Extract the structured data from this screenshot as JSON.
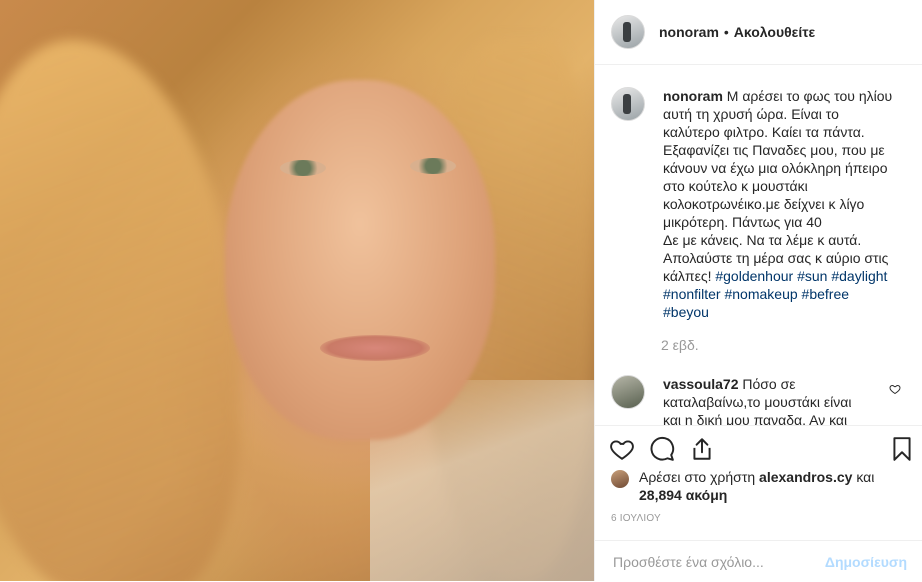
{
  "post": {
    "photo_alt": "",
    "header": {
      "username": "nonoram",
      "separator": "•",
      "follow_label": "Ακολουθείτε"
    },
    "caption": {
      "username": "nonoram",
      "text": "Μ αρέσει το φως του ηλίου αυτή τη χρυσή ώρα. Είναι το καλύτερο φιλτρο. Καίει τα πάντα. Εξαφανίζει τις Παναδες μου, που με κάνουν να έχω μια ολόκληρη ήπειρο στο κούτελο κ μουστάκι κολοκοτρωνέικο.με δείχνει κ λίγο μικρότερη. Πάντως για 40",
      "text2": "Δε με κάνεις. Να τα λέμε κ αυτά. Απολαύστε τη μέρα σας κ αύριο στις κάλπες!",
      "hashtags": [
        "#goldenhour",
        "#sun",
        "#daylight",
        "#nonfilter",
        "#nomakeup",
        "#befree",
        "#beyou"
      ],
      "time": "2 εβδ."
    },
    "comments": [
      {
        "username": "vassoula72",
        "text": "Πόσο σε καταλαβαίνω,το μουστάκι είναι και η δική μου παναδα. Αν και"
      }
    ],
    "likes": {
      "prefix": "Αρέσει στο χρήστη",
      "user": "alexandros.cy",
      "and": "και",
      "count": "28,894",
      "suffix": "ακόμη"
    },
    "date": "6 ΙΟΥΛΙΟΥ",
    "add_comment": {
      "placeholder": "Προσθέστε ένα σχόλιο...",
      "post_label": "Δημοσίευση"
    },
    "icons": [
      "heart-icon",
      "comment-icon",
      "share-icon",
      "bookmark-icon"
    ]
  }
}
